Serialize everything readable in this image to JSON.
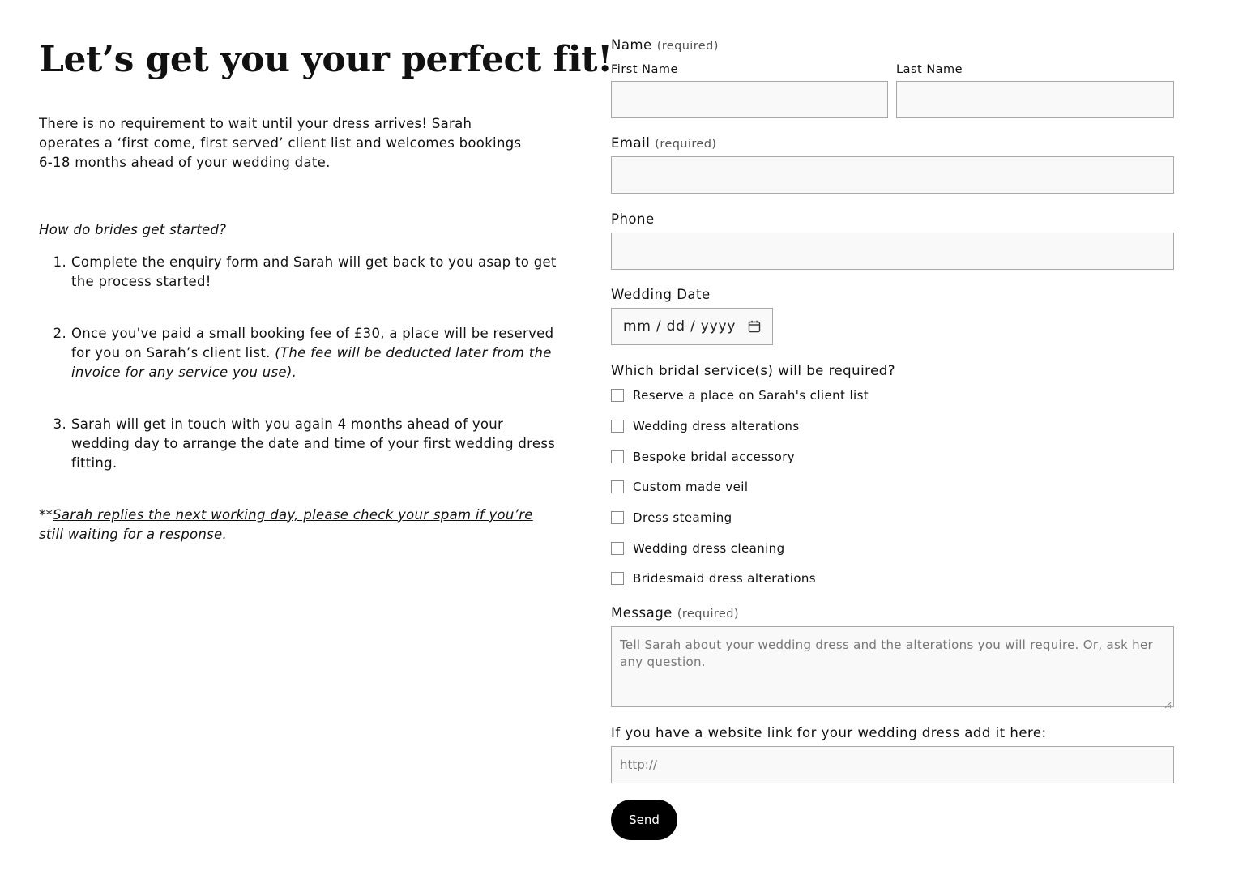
{
  "left": {
    "headline": "Let’s get you your perfect fit!",
    "intro": "There is no requirement to wait until your dress arrives! Sarah operates a ‘first come, first served’ client list and welcomes bookings 6-18 months ahead of your wedding date.",
    "started_heading": "How do brides get started?",
    "steps": [
      {
        "number": "1.",
        "text": "Complete the enquiry form and Sarah will get back to you asap to get the process started!",
        "italic": ""
      },
      {
        "number": "2.",
        "text": "Once you've paid a small booking fee of £30, a place will be reserved for you on Sarah’s client list. ",
        "italic": "(The fee will be deducted later from the invoice for any service you use)."
      },
      {
        "number": "3.",
        "text": "Sarah will get in touch with you again 4 months ahead of your wedding day to arrange the date and time of your first wedding dress fitting.",
        "italic": ""
      }
    ],
    "note_prefix": "**",
    "note_link": "Sarah replies the next working day, please check your spam if you’re still waiting for a response."
  },
  "form": {
    "name_label": "Name",
    "name_required": "(required)",
    "first_name_label": "First Name",
    "last_name_label": "Last Name",
    "email_label": "Email",
    "email_required": "(required)",
    "phone_label": "Phone",
    "wedding_date_label": "Wedding Date",
    "wedding_date_placeholder": "mm / dd / yyyy",
    "services_label": "Which bridal service(s) will be required?",
    "services": [
      "Reserve a place on Sarah's client list",
      "Wedding dress alterations",
      "Bespoke bridal accessory",
      "Custom made veil",
      "Dress steaming",
      "Wedding dress cleaning",
      "Bridesmaid dress alterations"
    ],
    "message_label": "Message",
    "message_required": "(required)",
    "message_placeholder": "Tell Sarah about your wedding dress and the alterations you will require. Or, ask her any question.",
    "website_label": "If you have a website link for your wedding dress add it here:",
    "website_placeholder": "http://",
    "send_label": "Send"
  },
  "colors": {
    "text": "#111111",
    "input_bg": "#f9f9f9",
    "input_border": "#a8a8a8",
    "button_bg": "#000000",
    "button_text": "#ffffff"
  },
  "icons": {
    "date_picker": "calendar-icon",
    "textarea_resize": "resize-grip-icon"
  }
}
